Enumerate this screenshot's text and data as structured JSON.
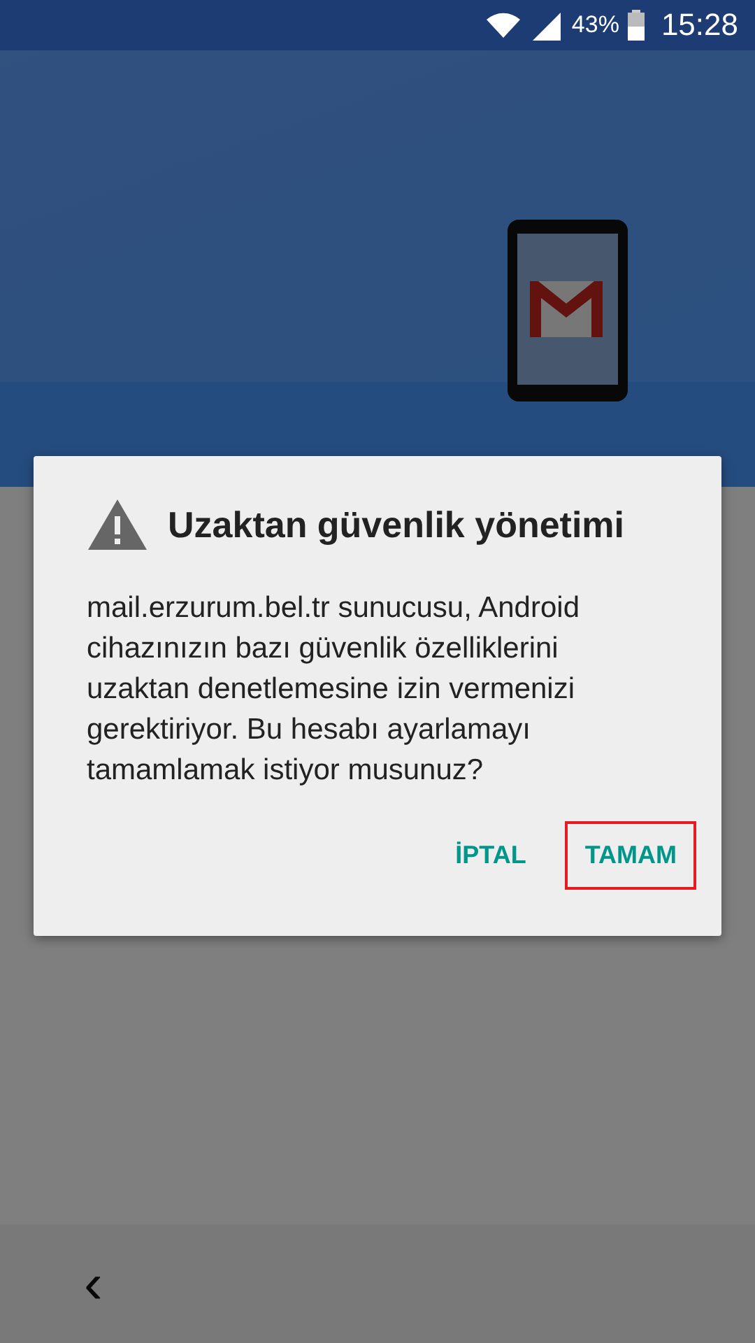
{
  "status_bar": {
    "battery": "43%",
    "time": "15:28"
  },
  "dialog": {
    "title": "Uzaktan güvenlik yönetimi",
    "message": "mail.erzurum.bel.tr sunucusu, Android cihazınızın bazı güvenlik özelliklerini uzaktan denetlemesine izin vermenizi gerektiriyor. Bu hesabı ayarlamayı tamamlamak istiyor musunuz?",
    "buttons": [
      {
        "label": "İPTAL",
        "highlighted": false
      },
      {
        "label": "TAMAM",
        "highlighted": true
      }
    ]
  },
  "nav": {
    "back": "‹"
  }
}
